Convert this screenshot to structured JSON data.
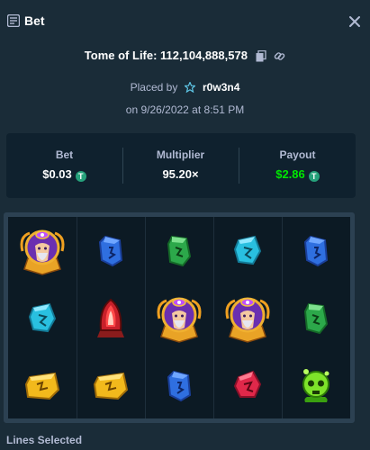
{
  "header": {
    "title": "Bet",
    "icon": "bet-slip-icon",
    "close_icon": "close-icon"
  },
  "game": {
    "name": "Tome of Life: 112,104,888,578",
    "copy_icon": "copy-icon",
    "link_icon": "link-icon"
  },
  "placed": {
    "prefix": "Placed by",
    "user_icon": "star-icon",
    "username": "r0w3n4"
  },
  "date": "on 9/26/2022 at 8:51 PM",
  "stats": {
    "bet_label": "Bet",
    "bet_value": "$0.03",
    "currency_icon": "T",
    "multiplier_label": "Multiplier",
    "multiplier_value": "95.20×",
    "payout_label": "Payout",
    "payout_value": "$2.86",
    "payout_color": "#00e701"
  },
  "board": {
    "reels": [
      [
        "wizard",
        "cyan-rune",
        "yellow-rune"
      ],
      [
        "blue-rune",
        "red-torch",
        "yellow-rune"
      ],
      [
        "green-rune",
        "wizard",
        "blue-rune"
      ],
      [
        "cyan-rune",
        "wizard",
        "red-rune"
      ],
      [
        "blue-rune",
        "green-rune",
        "green-skull"
      ]
    ]
  },
  "lines_label": "Lines Selected",
  "colors": {
    "background": "#1a2c38",
    "panel": "#0f212e",
    "accent_green": "#00e701",
    "muted_text": "#b1bad3"
  }
}
